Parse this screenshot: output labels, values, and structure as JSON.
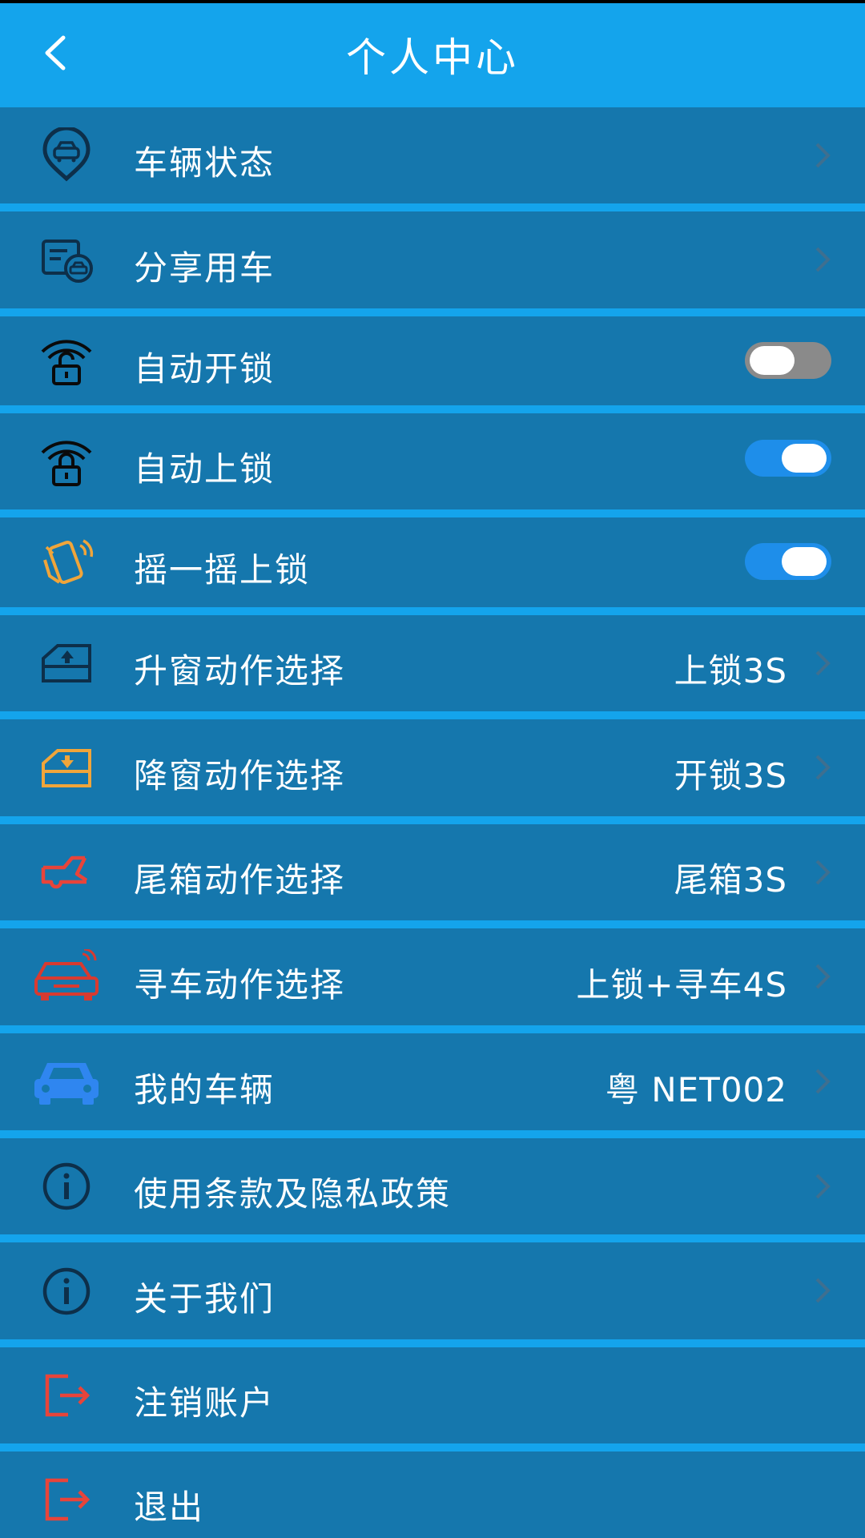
{
  "header": {
    "title": "个人中心"
  },
  "items": [
    {
      "label": "车辆状态"
    },
    {
      "label": "分享用车"
    },
    {
      "label": "自动开锁",
      "toggle": false
    },
    {
      "label": "自动上锁",
      "toggle": true
    },
    {
      "label": "摇一摇上锁",
      "toggle": true
    },
    {
      "label": "升窗动作选择",
      "value": "上锁3S"
    },
    {
      "label": "降窗动作选择",
      "value": "开锁3S"
    },
    {
      "label": "尾箱动作选择",
      "value": "尾箱3S"
    },
    {
      "label": "寻车动作选择",
      "value": "上锁+寻车4S"
    },
    {
      "label": "我的车辆",
      "value": "粤 NET002"
    },
    {
      "label": "使用条款及隐私政策"
    },
    {
      "label": "关于我们"
    },
    {
      "label": "注销账户"
    },
    {
      "label": "退出"
    }
  ],
  "colors": {
    "header": "#14a4ec",
    "row": "#1577ad",
    "toggle_on": "#1e8eea",
    "toggle_off": "#8a8a8a",
    "icon_dark": "#0d2f4a",
    "icon_orange": "#f0a53a",
    "icon_red": "#e8443a",
    "icon_blue": "#2f86f0"
  },
  "icons": [
    "car-location-icon",
    "share-car-icon",
    "unlock-wireless-icon",
    "lock-wireless-icon",
    "shake-phone-icon",
    "window-up-icon",
    "window-down-icon",
    "trunk-icon",
    "find-car-icon",
    "my-car-icon",
    "info-icon",
    "info-icon",
    "logout-icon",
    "logout-icon"
  ]
}
